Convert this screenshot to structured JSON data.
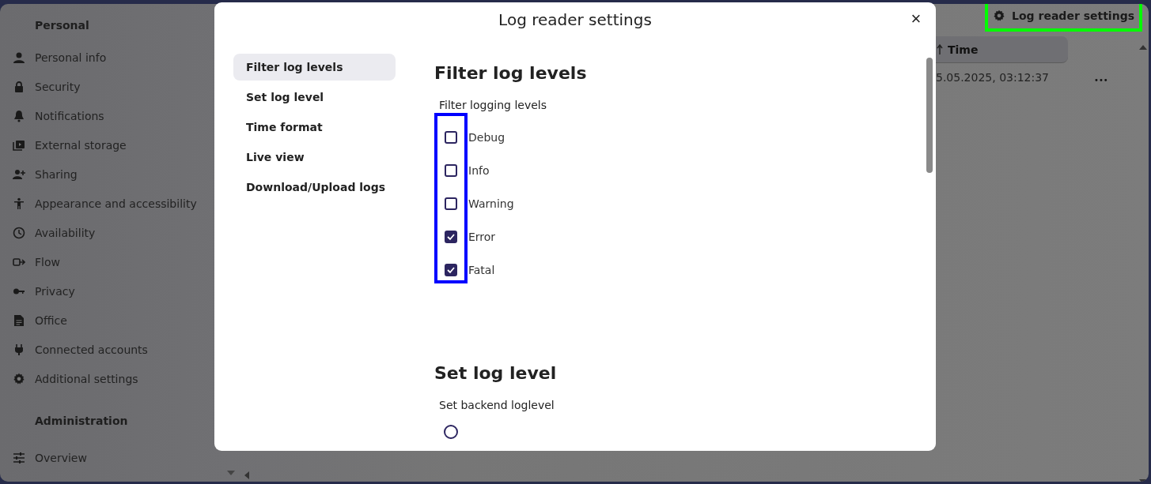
{
  "sidebar": {
    "sections": [
      {
        "title": "Personal",
        "items": [
          {
            "label": "Personal info"
          },
          {
            "label": "Security"
          },
          {
            "label": "Notifications"
          },
          {
            "label": "External storage"
          },
          {
            "label": "Sharing"
          },
          {
            "label": "Appearance and accessibility"
          },
          {
            "label": "Availability"
          },
          {
            "label": "Flow"
          },
          {
            "label": "Privacy"
          },
          {
            "label": "Office"
          },
          {
            "label": "Connected accounts"
          },
          {
            "label": "Additional settings"
          }
        ]
      },
      {
        "title": "Administration",
        "items": [
          {
            "label": "Overview"
          }
        ]
      }
    ]
  },
  "header": {
    "settings_button": {
      "label": "Log reader settings",
      "highlighted": true
    }
  },
  "table": {
    "columns": [
      {
        "label": "Time",
        "sorted": true
      }
    ],
    "rows": [
      {
        "time": "5.05.2025, 03:12:37",
        "actions": "•••"
      }
    ]
  },
  "dialog": {
    "title": "Log reader settings",
    "close": "×",
    "nav": [
      {
        "label": "Filter log levels",
        "selected": true
      },
      {
        "label": "Set log level",
        "selected": false
      },
      {
        "label": "Time format",
        "selected": false
      },
      {
        "label": "Live view",
        "selected": false
      },
      {
        "label": "Download/Upload logs",
        "selected": false
      }
    ],
    "filter_section": {
      "heading": "Filter log levels",
      "label": "Filter logging levels",
      "highlighted": true,
      "levels": [
        {
          "label": "Debug",
          "checked": false
        },
        {
          "label": "Info",
          "checked": false
        },
        {
          "label": "Warning",
          "checked": false
        },
        {
          "label": "Error",
          "checked": true
        },
        {
          "label": "Fatal",
          "checked": true
        }
      ]
    },
    "loglevel_section": {
      "heading": "Set log level",
      "label": "Set backend loglevel",
      "options": [
        {
          "selected": false
        }
      ]
    }
  }
}
